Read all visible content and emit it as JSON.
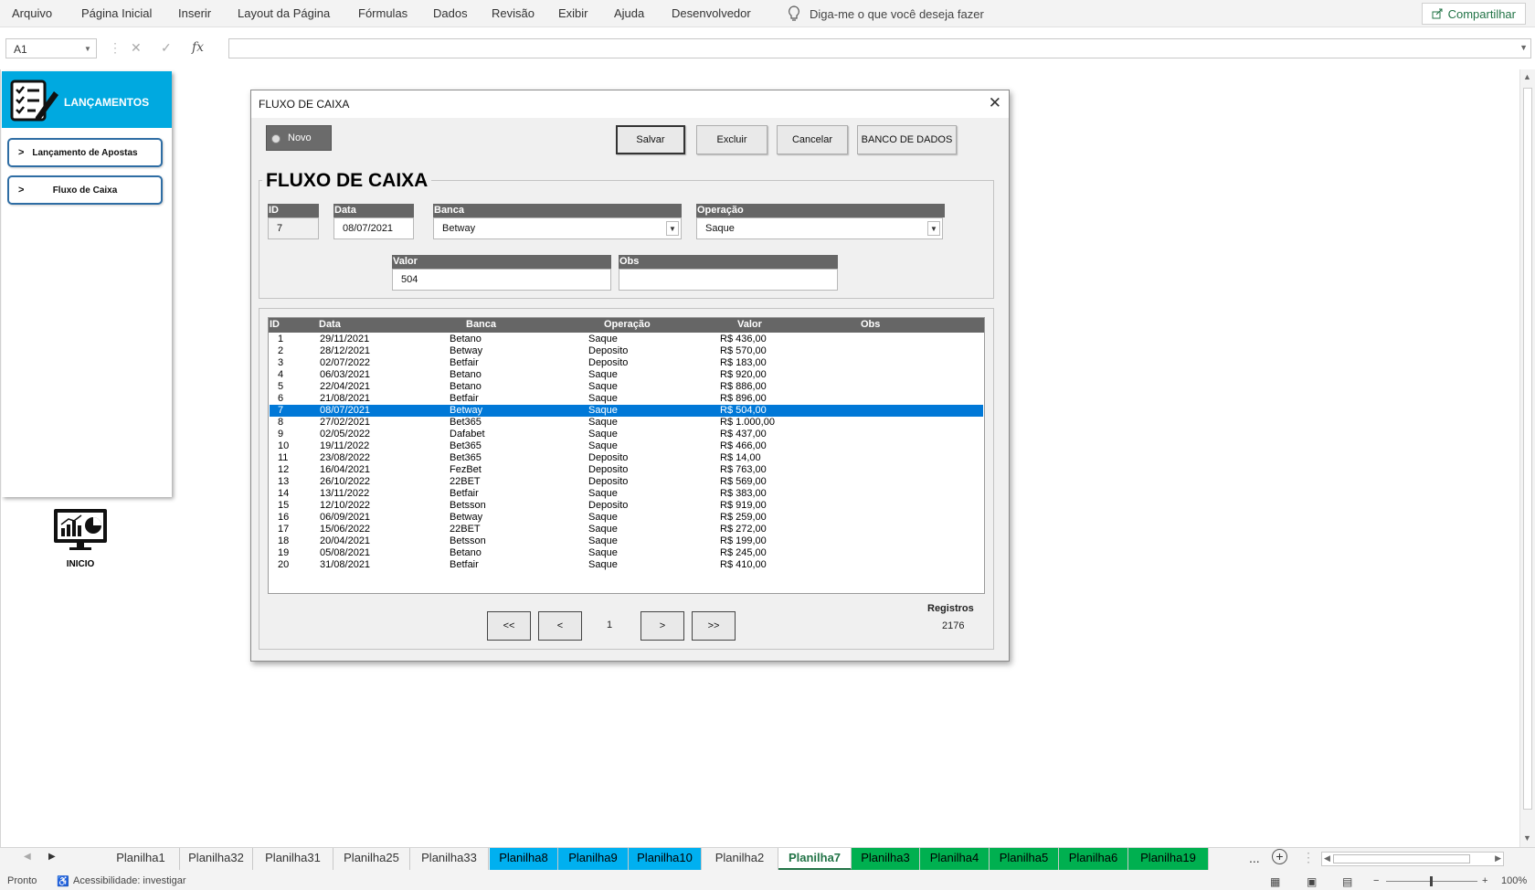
{
  "menu": {
    "items": [
      "Arquivo",
      "Página Inicial",
      "Inserir",
      "Layout da Página",
      "Fórmulas",
      "Dados",
      "Revisão",
      "Exibir",
      "Ajuda",
      "Desenvolvedor"
    ],
    "tellme": "Diga-me o que você deseja fazer",
    "share": "Compartilhar"
  },
  "formula_bar": {
    "name_box": "A1",
    "fx": "fx",
    "value": ""
  },
  "left_panel": {
    "title": "LANÇAMENTOS",
    "buttons": [
      {
        "arrow": ">",
        "label": "Lançamento de Apostas"
      },
      {
        "arrow": ">",
        "label": "Fluxo de Caixa"
      }
    ],
    "inicio_label": "INICIO"
  },
  "dialog": {
    "title": "FLUXO DE CAIXA",
    "close": "✕",
    "novo_label": "Novo",
    "buttons": {
      "salvar": "Salvar",
      "excluir": "Excluir",
      "cancelar": "Cancelar",
      "banco": "BANCO DE DADOS"
    },
    "frame_title": "FLUXO DE CAIXA",
    "fields": {
      "id": {
        "label": "ID",
        "value": "7"
      },
      "data": {
        "label": "Data",
        "value": "08/07/2021"
      },
      "banca": {
        "label": "Banca",
        "value": "Betway"
      },
      "operacao": {
        "label": "Operação",
        "value": "Saque"
      },
      "valor": {
        "label": "Valor",
        "value": "504"
      },
      "obs": {
        "label": "Obs",
        "value": ""
      }
    },
    "list": {
      "headers": [
        "ID",
        "Data",
        "Banca",
        "Operação",
        "Valor",
        "Obs"
      ],
      "selected_index": 6,
      "rows": [
        [
          "1",
          "29/11/2021",
          "Betano",
          "Saque",
          "R$ 436,00",
          ""
        ],
        [
          "2",
          "28/12/2021",
          "Betway",
          "Deposito",
          "R$ 570,00",
          ""
        ],
        [
          "3",
          "02/07/2022",
          "Betfair",
          "Deposito",
          "R$ 183,00",
          ""
        ],
        [
          "4",
          "06/03/2021",
          "Betano",
          "Saque",
          "R$ 920,00",
          ""
        ],
        [
          "5",
          "22/04/2021",
          "Betano",
          "Saque",
          "R$ 886,00",
          ""
        ],
        [
          "6",
          "21/08/2021",
          "Betfair",
          "Saque",
          "R$ 896,00",
          ""
        ],
        [
          "7",
          "08/07/2021",
          "Betway",
          "Saque",
          "R$ 504,00",
          ""
        ],
        [
          "8",
          "27/02/2021",
          "Bet365",
          "Saque",
          "R$ 1.000,00",
          ""
        ],
        [
          "9",
          "02/05/2022",
          "Dafabet",
          "Saque",
          "R$ 437,00",
          ""
        ],
        [
          "10",
          "19/11/2022",
          "Bet365",
          "Saque",
          "R$ 466,00",
          ""
        ],
        [
          "11",
          "23/08/2022",
          "Bet365",
          "Deposito",
          "R$ 14,00",
          ""
        ],
        [
          "12",
          "16/04/2021",
          "FezBet",
          "Deposito",
          "R$ 763,00",
          ""
        ],
        [
          "13",
          "26/10/2022",
          "22BET",
          "Deposito",
          "R$ 569,00",
          ""
        ],
        [
          "14",
          "13/11/2022",
          "Betfair",
          "Saque",
          "R$ 383,00",
          ""
        ],
        [
          "15",
          "12/10/2022",
          "Betsson",
          "Deposito",
          "R$ 919,00",
          ""
        ],
        [
          "16",
          "06/09/2021",
          "Betway",
          "Saque",
          "R$ 259,00",
          ""
        ],
        [
          "17",
          "15/06/2022",
          "22BET",
          "Saque",
          "R$ 272,00",
          ""
        ],
        [
          "18",
          "20/04/2021",
          "Betsson",
          "Saque",
          "R$ 199,00",
          ""
        ],
        [
          "19",
          "05/08/2021",
          "Betano",
          "Saque",
          "R$ 245,00",
          ""
        ],
        [
          "20",
          "31/08/2021",
          "Betfair",
          "Saque",
          "R$ 410,00",
          ""
        ]
      ]
    },
    "pager": {
      "first": "<<",
      "prev": "<",
      "page": "1",
      "next": ">",
      "last": ">>"
    },
    "registros": {
      "label": "Registros",
      "count": "2176"
    }
  },
  "tabs": [
    {
      "label": "Planilha1",
      "style": "normal"
    },
    {
      "label": "Planilha32",
      "style": "normal"
    },
    {
      "label": "Planilha31",
      "style": "normal"
    },
    {
      "label": "Planilha25",
      "style": "normal"
    },
    {
      "label": "Planilha33",
      "style": "normal"
    },
    {
      "label": "Planilha8",
      "style": "blue"
    },
    {
      "label": "Planilha9",
      "style": "blue"
    },
    {
      "label": "Planilha10",
      "style": "blue"
    },
    {
      "label": "Planilha2",
      "style": "normal"
    },
    {
      "label": "Planilha7",
      "style": "active"
    },
    {
      "label": "Planilha3",
      "style": "green"
    },
    {
      "label": "Planilha4",
      "style": "green"
    },
    {
      "label": "Planilha5",
      "style": "green"
    },
    {
      "label": "Planilha6",
      "style": "green"
    },
    {
      "label": "Planilha19",
      "style": "green"
    }
  ],
  "tabs_more": "...",
  "status": {
    "ready": "Pronto",
    "accessibility": "Acessibilidade: investigar",
    "zoom": "100%"
  },
  "colors": {
    "accent_blue": "#00a9e0",
    "selection": "#0078d7",
    "tab_blue": "#00b0f0",
    "tab_green": "#00b050",
    "header_gray": "#666666"
  }
}
